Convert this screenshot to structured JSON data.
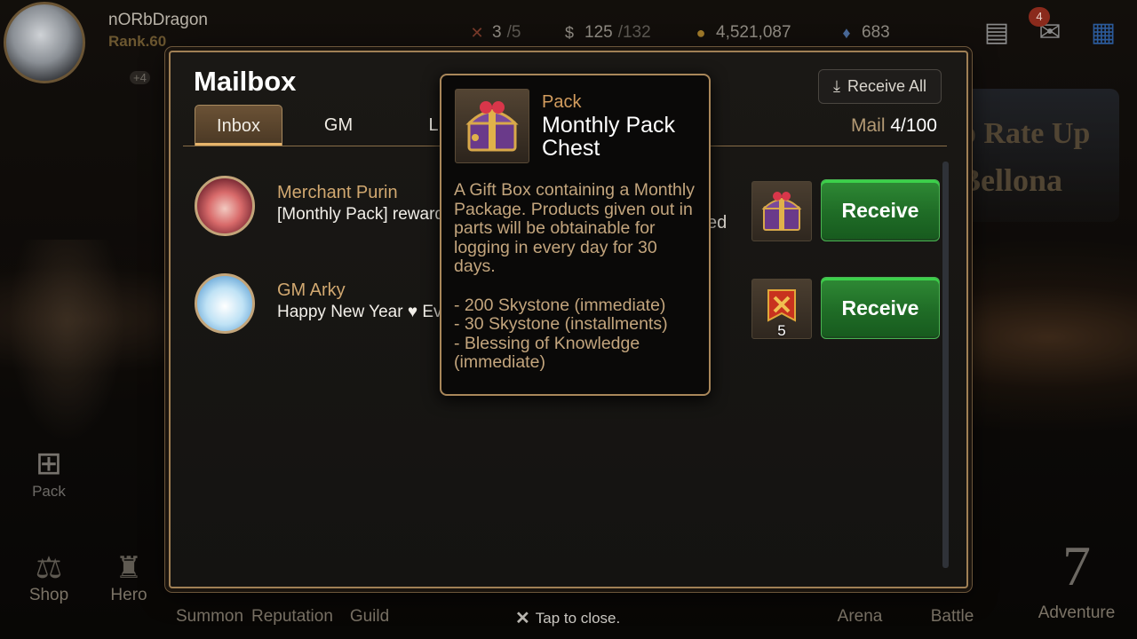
{
  "player": {
    "name": "nORbDragon",
    "rank": "Rank.60",
    "badge": "+4"
  },
  "currencies": [
    {
      "icon": "flag-icon",
      "value": "3",
      "sub": "/5"
    },
    {
      "icon": "stamina-icon",
      "value": "125",
      "sub": "/132"
    },
    {
      "icon": "gold-icon",
      "value": "4,521,087",
      "sub": ""
    },
    {
      "icon": "skystone-icon",
      "value": "683",
      "sub": ""
    }
  ],
  "notifications": {
    "mail_count": "4"
  },
  "background": {
    "side_nav": {
      "pack": "Pack"
    },
    "banner": {
      "line1": "p Rate Up",
      "line2": "Bellona"
    },
    "bottom_nav": [
      "Shop",
      "Hero",
      "Summon",
      "Reputation",
      "Guild",
      "Arena",
      "Battle",
      "Adventure"
    ],
    "adventure_number": "7"
  },
  "mailbox": {
    "title": "Mailbox",
    "tabs": [
      "Inbox",
      "GM",
      "L"
    ],
    "receive_all": "Receive All",
    "mail_label": "Mail",
    "mail_count": "4/100",
    "mails": [
      {
        "sender": "Merchant Purin",
        "subject": "[Monthly Pack] reward",
        "subject_tail": "ed",
        "item_icon": "treasure-chest-icon",
        "item_qty": "",
        "button": "Receive"
      },
      {
        "sender": "GM Arky",
        "subject": "Happy New Year ♥ Eve",
        "item_icon": "flag-ticket-icon",
        "item_qty": "5",
        "button": "Receive"
      }
    ]
  },
  "tooltip": {
    "type": "Pack",
    "title": "Monthly Pack Chest",
    "description": "A Gift Box containing a Monthly Package. Products given out in parts will be obtainable for logging in every day for 30 days.\n\n- 200 Skystone (immediate)\n- 30 Skystone (installments)\n- Blessing of Knowledge (immediate)"
  },
  "footer": {
    "tap_to_close": "Tap to close."
  }
}
